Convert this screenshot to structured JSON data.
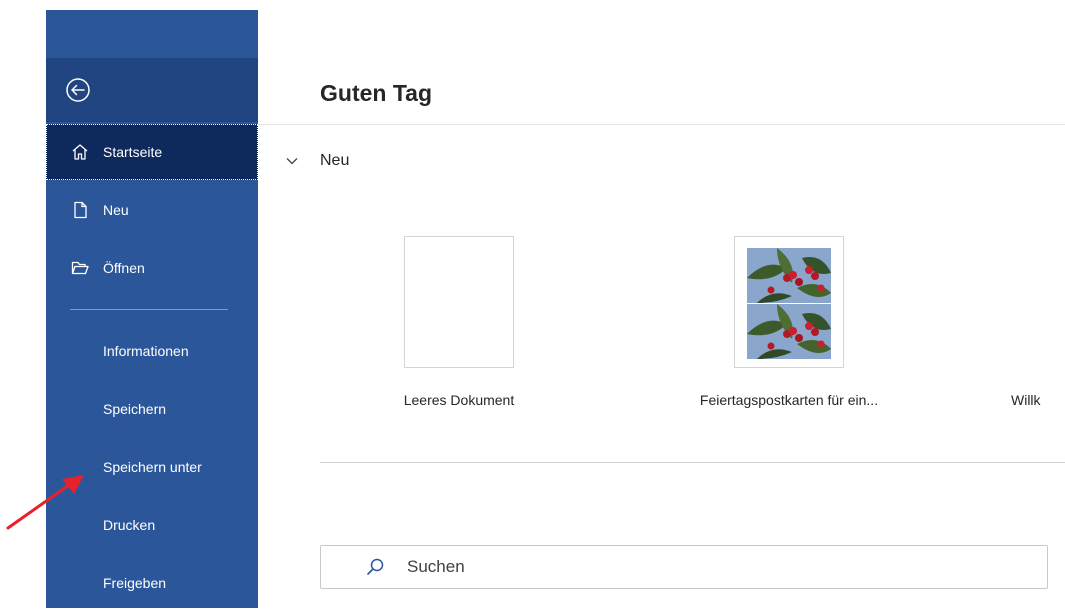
{
  "sidebar": {
    "back_label": "Zurück",
    "items": [
      {
        "label": "Startseite",
        "icon": "home-icon",
        "active": true
      },
      {
        "label": "Neu",
        "icon": "new-document-icon"
      },
      {
        "label": "Öffnen",
        "icon": "open-folder-icon"
      },
      {
        "label": "Informationen"
      },
      {
        "label": "Speichern"
      },
      {
        "label": "Speichern unter"
      },
      {
        "label": "Drucken"
      },
      {
        "label": "Freigeben"
      }
    ]
  },
  "main": {
    "greeting": "Guten Tag",
    "new_section": {
      "title": "Neu",
      "templates": [
        {
          "caption": "Leeres Dokument"
        },
        {
          "caption": "Feiertagspostkarten für ein..."
        },
        {
          "caption": "Willk"
        }
      ]
    },
    "search": {
      "placeholder": "Suchen"
    }
  },
  "colors": {
    "sidebar": "#2b579a",
    "sidebar_active": "#0e2a5c",
    "annotation_arrow": "#e8202a"
  }
}
